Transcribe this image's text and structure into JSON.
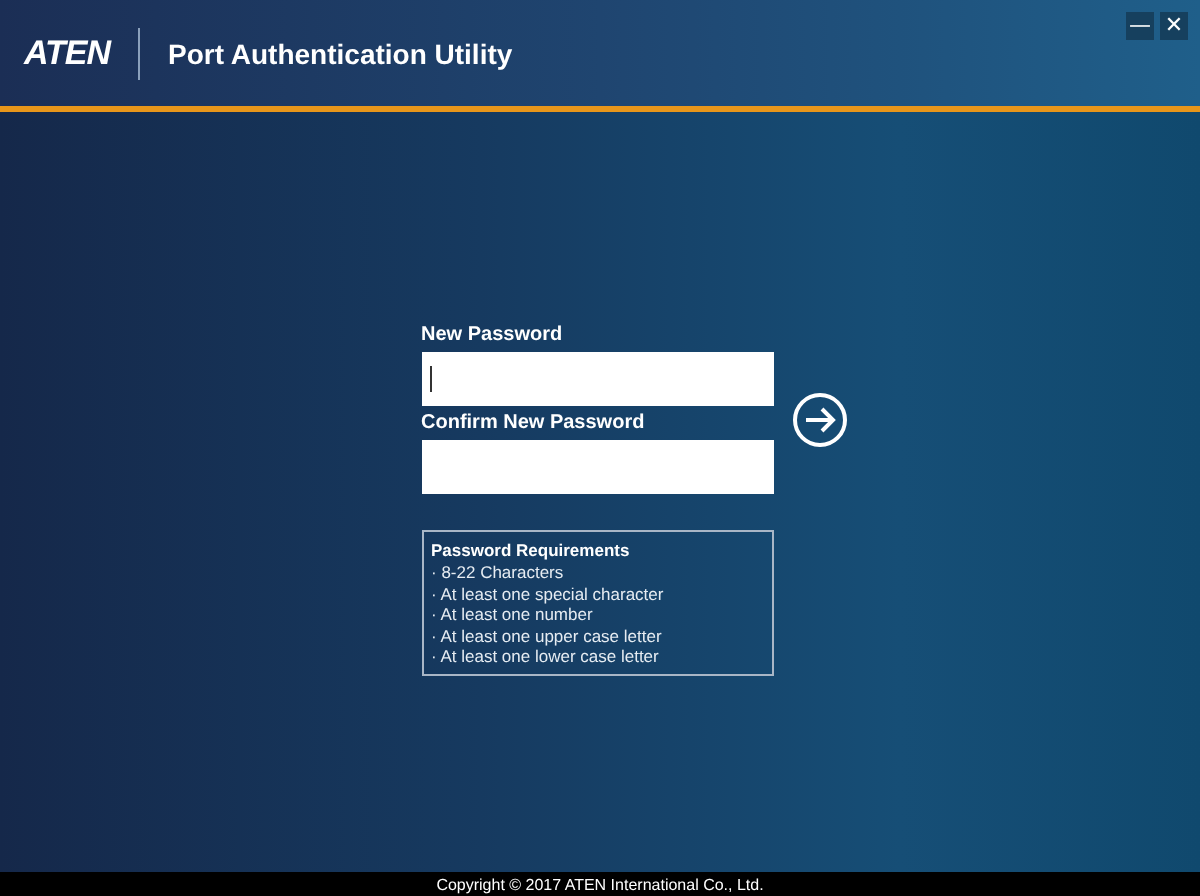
{
  "header": {
    "logo": "ATEN",
    "title": "Port Authentication Utility"
  },
  "window_controls": [
    "—",
    "✕"
  ],
  "form": {
    "fields": [
      {
        "label": "New Password",
        "focused": true
      },
      {
        "label": "Confirm New Password",
        "focused": false
      }
    ]
  },
  "requirements": {
    "title": "Password Requirements",
    "items": [
      "· 8-22 Characters",
      "· At least one special character",
      "· At least one number",
      "· At least one upper case letter",
      "· At least one lower case letter"
    ]
  },
  "footer": "Copyright © 2017 ATEN International Co., Ltd."
}
